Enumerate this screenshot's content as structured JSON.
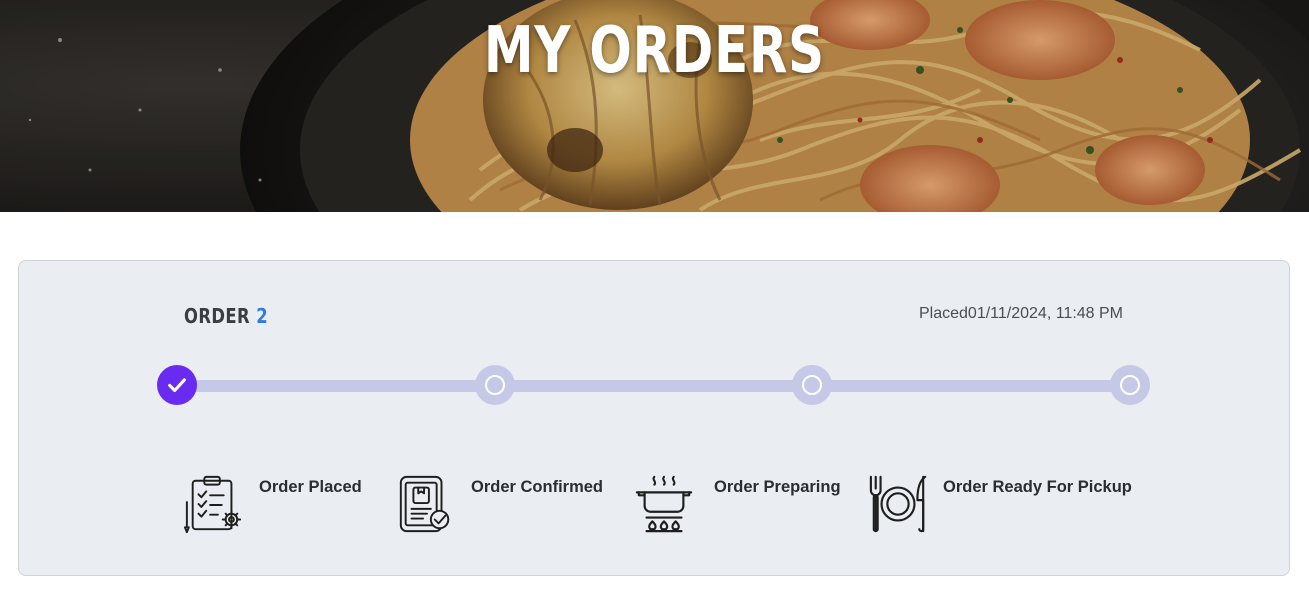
{
  "hero": {
    "title": "MY ORDERS"
  },
  "order": {
    "label": "ORDER",
    "number": "2",
    "placed_prefix": "Placed",
    "placed_datetime": "01/11/2024, 11:48 PM",
    "current_step": 1,
    "steps": [
      {
        "label": "Order Placed",
        "icon": "clipboard-checklist-gear-icon",
        "completed": true
      },
      {
        "label": "Order Confirmed",
        "icon": "phone-order-check-icon",
        "completed": false
      },
      {
        "label": "Order Preparing",
        "icon": "cooking-pot-icon",
        "completed": false
      },
      {
        "label": "Order Ready For Pickup",
        "icon": "plate-fork-knife-icon",
        "completed": false
      }
    ]
  },
  "colors": {
    "accent_done": "#6a2bf0",
    "track": "#c6c8e8",
    "order_number": "#2f7be3",
    "card_bg": "#eaedf1"
  }
}
